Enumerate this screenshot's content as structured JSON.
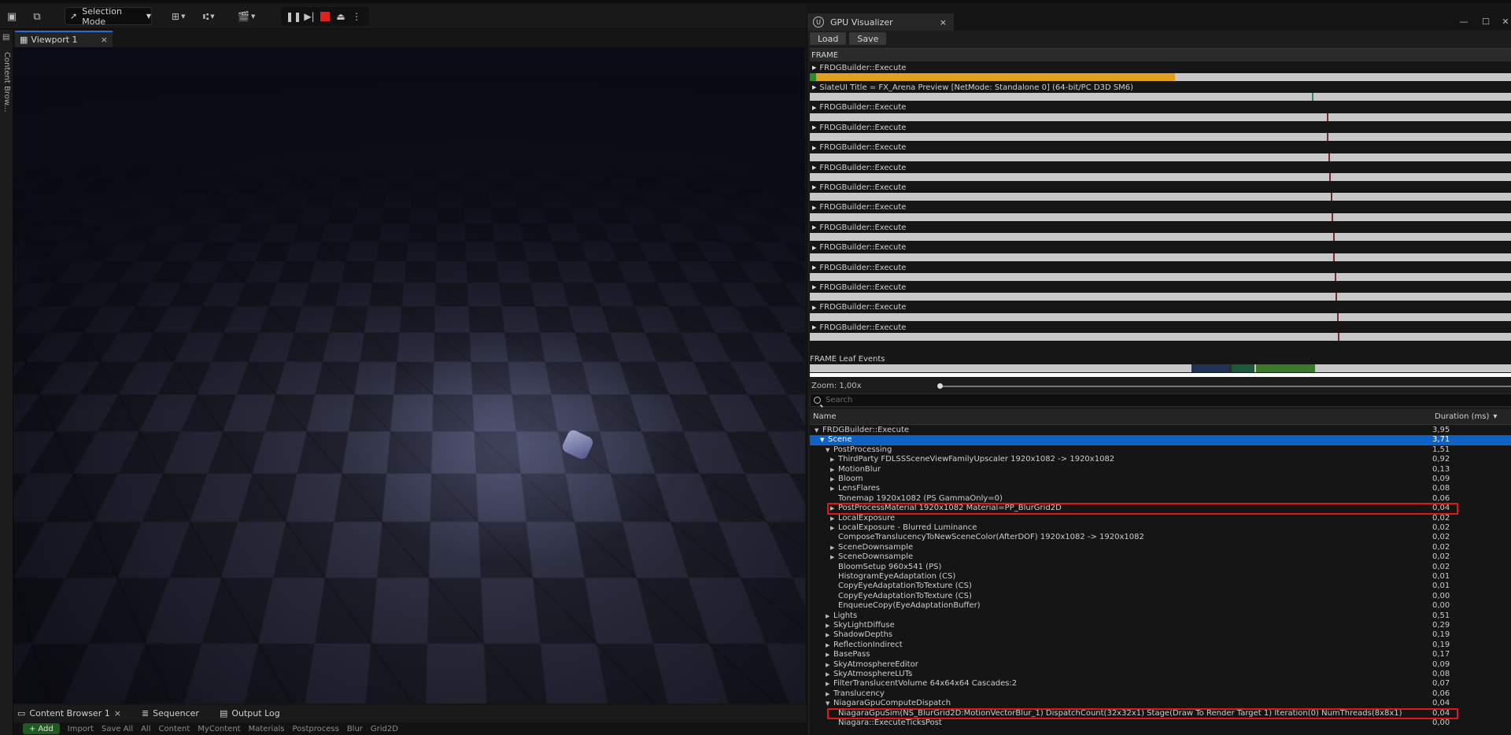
{
  "toolbar": {
    "mode_label": "Selection Mode",
    "icons": [
      "save-icon",
      "content-icon",
      "add-actor-icon",
      "blueprint-icon",
      "cinematics-icon"
    ],
    "play_controls": [
      "pause-icon",
      "step-icon",
      "stop-icon",
      "eject-icon",
      "more-icon"
    ]
  },
  "left_rail": {
    "label": "Content Brow..."
  },
  "viewport": {
    "tab_label": "Viewport 1",
    "close": "×"
  },
  "drawer": {
    "tabs": [
      {
        "label": "Content Browser 1",
        "icon": "folder-icon",
        "close": "×"
      },
      {
        "label": "Sequencer",
        "icon": "sequencer-icon"
      },
      {
        "label": "Output Log",
        "icon": "log-icon"
      }
    ],
    "add_label": "Add",
    "import_label": "Import",
    "save_all_label": "Save All",
    "breadcrumbs": [
      "All",
      "Content",
      "MyContent",
      "Materials",
      "Postprocess",
      "Blur",
      "Grid2D"
    ]
  },
  "gpu": {
    "title": "GPU Visualizer",
    "close": "×",
    "window_controls": {
      "minimize": "—",
      "maximize": "☐",
      "close": "✕"
    },
    "load_label": "Load",
    "save_label": "Save",
    "frame_label": "FRAME",
    "graph_rows": [
      {
        "label": "FRDGBuilder::Execute",
        "fill_percent": 52,
        "has_start": true
      },
      {
        "label": "SlateUI Title = FX_Arena Preview [NetMode: Standalone 0]  (64-bit/PC D3D SM6)",
        "marker_percent": 71.5,
        "marker_color": "#2c8c6c"
      },
      {
        "label": "FRDGBuilder::Execute",
        "marker_percent": 73.6
      },
      {
        "label": "FRDGBuilder::Execute",
        "marker_percent": 73.7
      },
      {
        "label": "FRDGBuilder::Execute",
        "marker_percent": 73.9
      },
      {
        "label": "FRDGBuilder::Execute",
        "marker_percent": 74.0
      },
      {
        "label": "FRDGBuilder::Execute",
        "marker_percent": 74.2
      },
      {
        "label": "FRDGBuilder::Execute",
        "marker_percent": 74.3
      },
      {
        "label": "FRDGBuilder::Execute",
        "marker_percent": 74.5
      },
      {
        "label": "FRDGBuilder::Execute",
        "marker_percent": 74.6
      },
      {
        "label": "FRDGBuilder::Execute",
        "marker_percent": 74.8
      },
      {
        "label": "FRDGBuilder::Execute",
        "marker_percent": 74.9
      },
      {
        "label": "FRDGBuilder::Execute",
        "marker_percent": 75.1
      },
      {
        "label": "FRDGBuilder::Execute",
        "marker_percent": 75.2
      }
    ],
    "leaf_label": "FRAME Leaf Events",
    "leaf_segments": [
      {
        "start_percent": 54.4,
        "width_percent": 5.4,
        "color": "#1f3355"
      },
      {
        "start_percent": 59.8,
        "width_percent": 0.3,
        "color": "#2d2d2d"
      },
      {
        "start_percent": 60.1,
        "width_percent": 3.2,
        "color": "#1a5a3a"
      },
      {
        "start_percent": 63.3,
        "width_percent": 0.3,
        "color": "#c8c8c8"
      },
      {
        "start_percent": 63.6,
        "width_percent": 8.4,
        "color": "#3a7a2a"
      }
    ],
    "zoom_label": "Zoom: 1,00x",
    "search_placeholder": "Search",
    "columns": {
      "name": "Name",
      "duration": "Duration (ms)",
      "sort_icon": "▾"
    },
    "rows": [
      {
        "name": "FRDGBuilder::Execute",
        "duration": "3,95",
        "depth": 0,
        "expander": "open"
      },
      {
        "name": "Scene",
        "duration": "3,71",
        "depth": 1,
        "expander": "open",
        "selected": true
      },
      {
        "name": "PostProcessing",
        "duration": "1,51",
        "depth": 2,
        "expander": "open"
      },
      {
        "name": "ThirdParty FDLSSSceneViewFamilyUpscaler 1920x1082 -> 1920x1082",
        "duration": "0,92",
        "depth": 3,
        "expander": "closed"
      },
      {
        "name": "MotionBlur",
        "duration": "0,13",
        "depth": 3,
        "expander": "closed"
      },
      {
        "name": "Bloom",
        "duration": "0,09",
        "depth": 3,
        "expander": "closed"
      },
      {
        "name": "LensFlares",
        "duration": "0,08",
        "depth": 3,
        "expander": "closed"
      },
      {
        "name": "Tonemap 1920x1082 (PS GammaOnly=0)",
        "duration": "0,06",
        "depth": 3,
        "expander": "none"
      },
      {
        "name": "PostProcessMaterial 1920x1082 Material=PP_BlurGrid2D",
        "duration": "0,04",
        "depth": 3,
        "expander": "closed",
        "highlight": true
      },
      {
        "name": "LocalExposure",
        "duration": "0,02",
        "depth": 3,
        "expander": "closed"
      },
      {
        "name": "LocalExposure - Blurred Luminance",
        "duration": "0,02",
        "depth": 3,
        "expander": "closed"
      },
      {
        "name": "ComposeTranslucencyToNewSceneColor(AfterDOF) 1920x1082 -> 1920x1082",
        "duration": "0,02",
        "depth": 3,
        "expander": "none"
      },
      {
        "name": "SceneDownsample",
        "duration": "0,02",
        "depth": 3,
        "expander": "closed"
      },
      {
        "name": "SceneDownsample",
        "duration": "0,02",
        "depth": 3,
        "expander": "closed"
      },
      {
        "name": "BloomSetup 960x541 (PS)",
        "duration": "0,02",
        "depth": 3,
        "expander": "none"
      },
      {
        "name": "HistogramEyeAdaptation (CS)",
        "duration": "0,01",
        "depth": 3,
        "expander": "none"
      },
      {
        "name": "CopyEyeAdaptationToTexture (CS)",
        "duration": "0,01",
        "depth": 3,
        "expander": "none"
      },
      {
        "name": "CopyEyeAdaptationToTexture (CS)",
        "duration": "0,00",
        "depth": 3,
        "expander": "none"
      },
      {
        "name": "EnqueueCopy(EyeAdaptationBuffer)",
        "duration": "0,00",
        "depth": 3,
        "expander": "none"
      },
      {
        "name": "Lights",
        "duration": "0,51",
        "depth": 2,
        "expander": "closed"
      },
      {
        "name": "SkyLightDiffuse",
        "duration": "0,29",
        "depth": 2,
        "expander": "closed"
      },
      {
        "name": "ShadowDepths",
        "duration": "0,19",
        "depth": 2,
        "expander": "closed"
      },
      {
        "name": "ReflectionIndirect",
        "duration": "0,19",
        "depth": 2,
        "expander": "closed"
      },
      {
        "name": "BasePass",
        "duration": "0,17",
        "depth": 2,
        "expander": "closed"
      },
      {
        "name": "SkyAtmosphereEditor",
        "duration": "0,09",
        "depth": 2,
        "expander": "closed"
      },
      {
        "name": "SkyAtmosphereLUTs",
        "duration": "0,08",
        "depth": 2,
        "expander": "closed"
      },
      {
        "name": "FilterTranslucentVolume 64x64x64 Cascades:2",
        "duration": "0,07",
        "depth": 2,
        "expander": "closed"
      },
      {
        "name": "Translucency",
        "duration": "0,06",
        "depth": 2,
        "expander": "closed"
      },
      {
        "name": "NiagaraGpuComputeDispatch",
        "duration": "0,04",
        "depth": 2,
        "expander": "open"
      },
      {
        "name": "NiagaraGpuSim(NS_BlurGrid2D:MotionVectorBlur_1) DispatchCount(32x32x1) Stage(Draw To Render Target 1) Iteration(0) NumThreads(8x8x1)",
        "duration": "0,04",
        "depth": 3,
        "expander": "none",
        "highlight": true
      },
      {
        "name": "Niagara::ExecuteTicksPost",
        "duration": "0,00",
        "depth": 3,
        "expander": "none"
      }
    ],
    "highlight_color": "#e01818",
    "selection_color": "#0f62c5",
    "fill_color": "#e2a020"
  }
}
